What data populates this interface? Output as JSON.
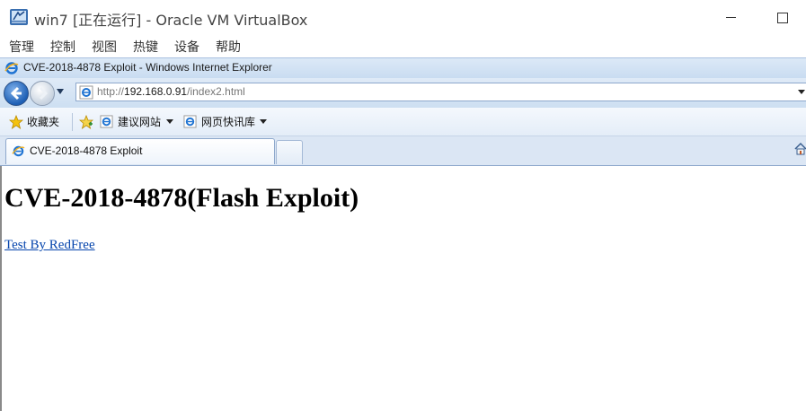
{
  "vbox": {
    "title": "win7 [正在运行] - Oracle VM VirtualBox",
    "menu": [
      "管理",
      "控制",
      "视图",
      "热键",
      "设备",
      "帮助"
    ]
  },
  "ie": {
    "title": "CVE-2018-4878 Exploit - Windows Internet Explorer",
    "address": {
      "scheme": "http://",
      "host": "192.168.0.91",
      "path": "/index2.html"
    },
    "favorites": {
      "label": "收藏夹",
      "links": [
        "建议网站",
        "网页快讯库"
      ]
    },
    "tab_label": "CVE-2018-4878 Exploit"
  },
  "page": {
    "heading": "CVE-2018-4878(Flash Exploit)",
    "link_text": "Test By RedFree"
  },
  "colors": {
    "link": "#0645ad",
    "chrome_blue": "#dce9f7"
  }
}
